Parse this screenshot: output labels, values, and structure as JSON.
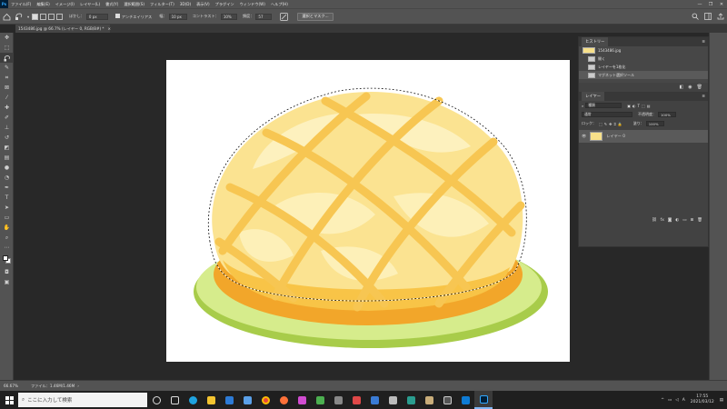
{
  "menu": {
    "items": [
      "ファイル(F)",
      "編集(E)",
      "イメージ(I)",
      "レイヤー(L)",
      "書式(Y)",
      "選択範囲(S)",
      "フィルター(T)",
      "3D(D)",
      "表示(V)",
      "プラグイン",
      "ウィンドウ(W)",
      "ヘルプ(H)"
    ]
  },
  "options": {
    "feather_label": "ぼかし：",
    "feather_value": "0 px",
    "antialias_label": "アンチエイリアス",
    "width_label": "幅：",
    "width_value": "10 px",
    "contrast_label": "コントラスト：",
    "contrast_value": "10%",
    "frequency_label": "頻度：",
    "frequency_value": "57",
    "select_mask_label": "選択とマスク..."
  },
  "document": {
    "tab_label": "1543486.jpg @ 66.7% (レイヤー 0, RGB/8#) *",
    "zoom": "66.67%",
    "file_info": "ファイル：1.46M/1.46M"
  },
  "history": {
    "title": "ヒストリー",
    "items": [
      "1543486.jpg",
      "開く",
      "レイヤーを1枚化",
      "マグネット選択ツール"
    ]
  },
  "layers": {
    "title": "レイヤー",
    "kind_label": "種類",
    "blend_mode": "通常",
    "opacity_label": "不透明度：",
    "opacity_value": "100%",
    "lock_label": "ロック：",
    "fill_label": "塗り：",
    "fill_value": "100%",
    "layer_name": "レイヤー 0"
  },
  "taskbar": {
    "search_placeholder": "ここに入力して検索",
    "time": "17:55",
    "date": "2021/03/12"
  },
  "colors": {
    "app_dark": "#282828",
    "panel": "#535353",
    "taskbar": "#1f1f1f",
    "bun_light": "#fbe9a0",
    "bun_dark": "#f5b93a",
    "plate": "#c8e27a"
  }
}
